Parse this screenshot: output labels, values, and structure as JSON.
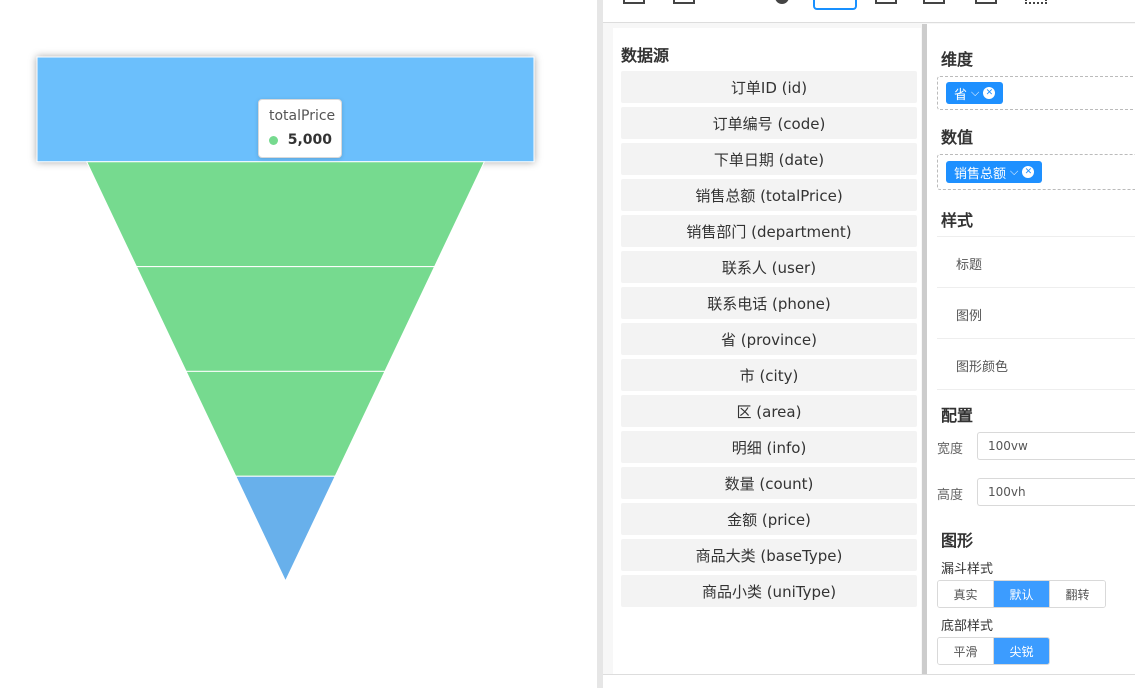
{
  "chart_data": {
    "type": "funnel",
    "value_field": "totalPrice",
    "segments": [
      {
        "value": 5000,
        "color": "#6bbffc",
        "highlighted": true
      },
      {
        "value": 4000,
        "color": "#76da8f"
      },
      {
        "value": 3000,
        "color": "#76da8f"
      },
      {
        "value": 2000,
        "color": "#76da8f"
      },
      {
        "value": 1000,
        "color": "#68b0eb"
      },
      {
        "value": 0,
        "color": "#76da8f"
      }
    ]
  },
  "tooltip": {
    "title": "totalPrice",
    "value": "5,000",
    "dot_color": "#76da8f"
  },
  "datasource": {
    "title": "数据源",
    "fields": [
      "订单ID (id)",
      "订单编号 (code)",
      "下单日期 (date)",
      "销售总额 (totalPrice)",
      "销售部门 (department)",
      "联系人 (user)",
      "联系电话 (phone)",
      "省 (province)",
      "市 (city)",
      "区 (area)",
      "明细 (info)",
      "数量 (count)",
      "金额 (price)",
      "商品大类 (baseType)",
      "商品小类 (uniType)"
    ]
  },
  "config": {
    "dimension_title": "维度",
    "dimension_chip": "省",
    "measure_title": "数值",
    "measure_chip": "销售总额",
    "style_title": "样式",
    "style_items": [
      "标题",
      "图例",
      "图形颜色"
    ],
    "layout_title": "配置",
    "width_label": "宽度",
    "width_value": "100vw",
    "height_label": "高度",
    "height_value": "100vh",
    "shape_title": "图形",
    "funnel_style_label": "漏斗样式",
    "funnel_style_options": [
      "真实",
      "默认",
      "翻转"
    ],
    "funnel_style_selected": "默认",
    "bottom_style_label": "底部样式",
    "bottom_style_options": [
      "平滑",
      "尖锐"
    ],
    "bottom_style_selected": "尖锐"
  },
  "colors": {
    "accent": "#1e90ff",
    "funnel_green": "#76da8f",
    "funnel_blue": "#6bbffc"
  }
}
